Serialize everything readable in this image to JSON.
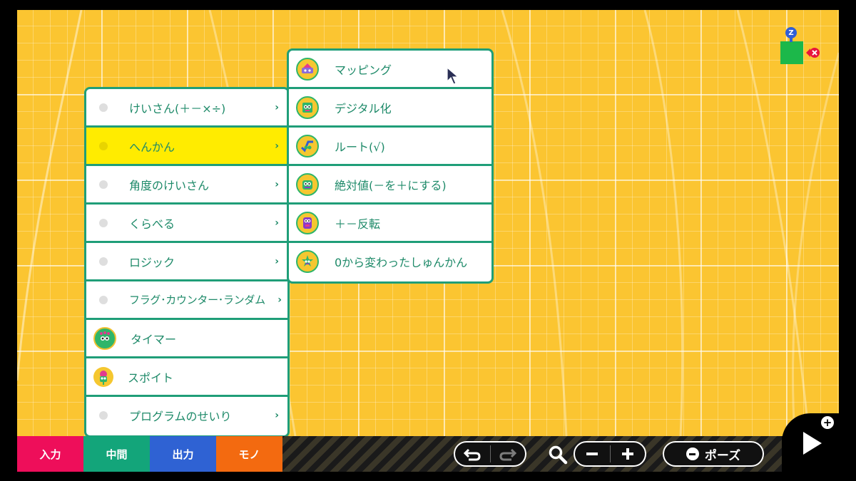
{
  "left_menu": [
    {
      "label": "けいさん(＋－×÷)",
      "icon": "dot-icon",
      "has_submenu": true
    },
    {
      "label": "へんかん",
      "icon": "dot-icon",
      "has_submenu": true,
      "active": true
    },
    {
      "label": "角度のけいさん",
      "icon": "dot-icon",
      "has_submenu": true
    },
    {
      "label": "くらべる",
      "icon": "dot-icon",
      "has_submenu": true
    },
    {
      "label": "ロジック",
      "icon": "dot-icon",
      "has_submenu": true
    },
    {
      "label": "フラグ･カウンター･ランダム",
      "icon": "dot-icon",
      "has_submenu": true
    },
    {
      "label": "タイマー",
      "icon": "timer-nodon-icon",
      "has_submenu": false
    },
    {
      "label": "スポイト",
      "icon": "dropper-nodon-icon",
      "has_submenu": false
    },
    {
      "label": "プログラムのせいり",
      "icon": "dot-icon",
      "has_submenu": true
    }
  ],
  "right_menu": [
    {
      "label": "マッピング",
      "icon": "mapping-nodon-icon"
    },
    {
      "label": "デジタル化",
      "icon": "digital-nodon-icon"
    },
    {
      "label": "ルート(√)",
      "icon": "root-nodon-icon"
    },
    {
      "label": "絶対値(－を＋にする)",
      "icon": "absolute-nodon-icon"
    },
    {
      "label": "＋－反転",
      "icon": "invert-nodon-icon"
    },
    {
      "label": "0から変わったしゅんかん",
      "icon": "changed-nodon-icon"
    }
  ],
  "tabs": [
    {
      "label": "入力",
      "color": "#ee0e5a"
    },
    {
      "label": "中間",
      "color": "#13a57a"
    },
    {
      "label": "出力",
      "color": "#2f62d3"
    },
    {
      "label": "モノ",
      "color": "#f36a10"
    }
  ],
  "toolbar": {
    "pause_label": "ポーズ",
    "zoom_out_icon": "minus-icon",
    "zoom_in_icon": "plus-icon"
  },
  "node": {
    "badge_letter": "Z",
    "color": "#1cb84a"
  },
  "colors": {
    "canvas": "#fbc531",
    "menu_border": "#1f9e78",
    "menu_text": "#1e8a69",
    "active_item": "#ffec00"
  }
}
